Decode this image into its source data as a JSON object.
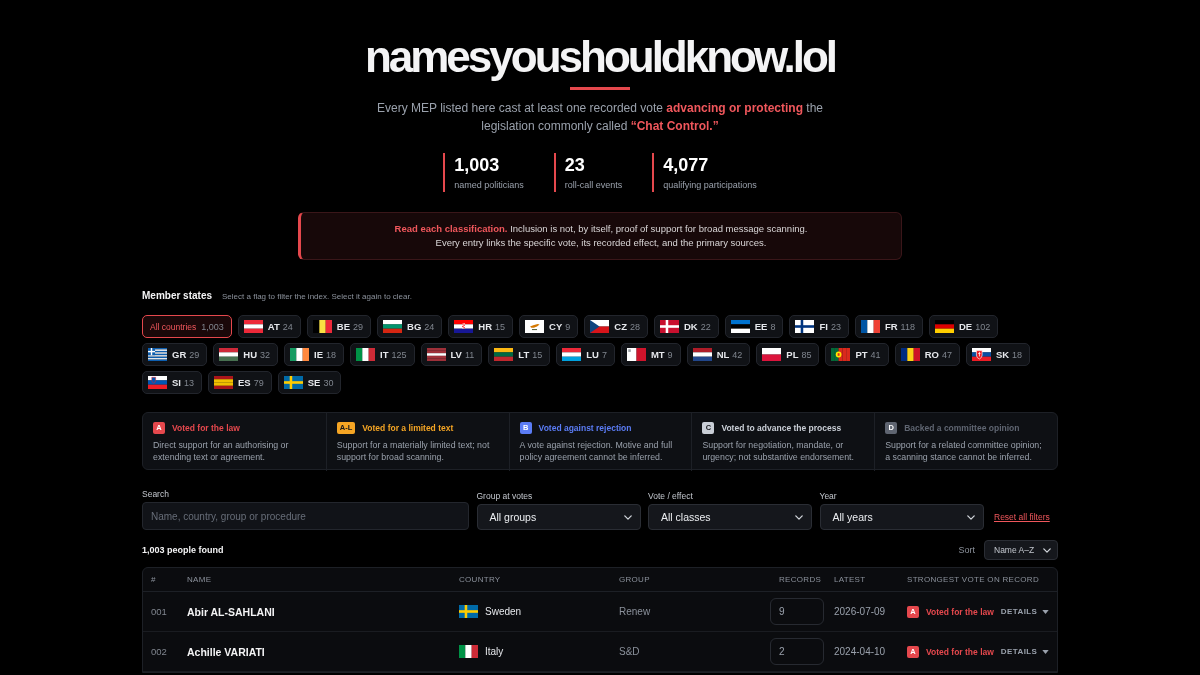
{
  "header": {
    "title": "namesyoushouldknow.lol",
    "intro": "Every MEP listed here cast at least one recorded vote **advancing or protecting** the legislation commonly called **“Chat Control.”**"
  },
  "stats": [
    {
      "value": "1,003",
      "label": "named politicians"
    },
    {
      "value": "23",
      "label": "roll-call events"
    },
    {
      "value": "4,077",
      "label": "qualifying participations"
    }
  ],
  "notice": {
    "lines": [
      "**Read each classification.** Inclusion is not, by itself, proof of support for broad message scanning.",
      "Every entry links the specific vote, its recorded effect, and the primary sources."
    ]
  },
  "member_states": {
    "heading": "Member states",
    "hint": "Select a flag to filter the index. Select it again to clear.",
    "chips": [
      {
        "kind": "all",
        "label": "All countries",
        "count": "1,003",
        "selected": true
      },
      {
        "kind": "austria",
        "label": "AT",
        "count": "24",
        "selected": false
      },
      {
        "kind": "belgium",
        "label": "BE",
        "count": "29",
        "selected": false
      },
      {
        "kind": "bulgaria",
        "label": "BG",
        "count": "24",
        "selected": false
      },
      {
        "kind": "croatia",
        "label": "HR",
        "count": "15",
        "selected": false
      },
      {
        "kind": "cyprus",
        "label": "CY",
        "count": "9",
        "selected": false
      },
      {
        "kind": "czechia",
        "label": "CZ",
        "count": "28",
        "selected": false
      },
      {
        "kind": "denmark",
        "label": "DK",
        "count": "22",
        "selected": false
      },
      {
        "kind": "estonia",
        "label": "EE",
        "count": "8",
        "selected": false
      },
      {
        "kind": "finland",
        "label": "FI",
        "count": "23",
        "selected": false
      },
      {
        "kind": "france",
        "label": "FR",
        "count": "118",
        "selected": false
      },
      {
        "kind": "germany",
        "label": "DE",
        "count": "102",
        "selected": false
      },
      {
        "kind": "greece",
        "label": "GR",
        "count": "29",
        "selected": false
      },
      {
        "kind": "hungary",
        "label": "HU",
        "count": "32",
        "selected": false
      },
      {
        "kind": "ireland",
        "label": "IE",
        "count": "18",
        "selected": false
      },
      {
        "kind": "italy",
        "label": "IT",
        "count": "125",
        "selected": false
      },
      {
        "kind": "latvia",
        "label": "LV",
        "count": "11",
        "selected": false
      },
      {
        "kind": "lithuania",
        "label": "LT",
        "count": "15",
        "selected": false
      },
      {
        "kind": "luxembourg",
        "label": "LU",
        "count": "7",
        "selected": false
      },
      {
        "kind": "malta",
        "label": "MT",
        "count": "9",
        "selected": false
      },
      {
        "kind": "netherlands",
        "label": "NL",
        "count": "42",
        "selected": false
      },
      {
        "kind": "poland",
        "label": "PL",
        "count": "85",
        "selected": false
      },
      {
        "kind": "portugal",
        "label": "PT",
        "count": "41",
        "selected": false
      },
      {
        "kind": "romania",
        "label": "RO",
        "count": "47",
        "selected": false
      },
      {
        "kind": "slovakia",
        "label": "SK",
        "count": "18",
        "selected": false
      },
      {
        "kind": "slovenia",
        "label": "SI",
        "count": "13",
        "selected": false
      },
      {
        "kind": "spain",
        "label": "ES",
        "count": "79",
        "selected": false
      },
      {
        "kind": "sweden",
        "label": "SE",
        "count": "30",
        "selected": false
      }
    ]
  },
  "classes": [
    {
      "badge": "A",
      "title": "Voted for the law",
      "description": "Direct support for an authorising or extending text or agreement.",
      "color": "#e5484d"
    },
    {
      "badge": "A-L",
      "title": "Voted for a limited text",
      "description": "Support for a materially limited text; not support for broad scanning.",
      "color": "#f5a524"
    },
    {
      "badge": "B",
      "title": "Voted against rejection",
      "description": "A vote against rejection. Motive and full policy agreement cannot be inferred.",
      "color": "#5b7cf5"
    },
    {
      "badge": "C",
      "title": "Voted to advance the process",
      "description": "Support for negotiation, mandate, or urgency; not substantive endorsement.",
      "color": "#c9ced6"
    },
    {
      "badge": "D",
      "title": "Backed a committee opinion",
      "description": "Support for a related committee opinion; a scanning stance cannot be inferred.",
      "color": "#5f6571"
    }
  ],
  "filters": {
    "search": {
      "label": "Search",
      "placeholder": "Name, country, group or procedure"
    },
    "selects": [
      {
        "label": "Group at votes",
        "value": "All groups"
      },
      {
        "label": "Vote / effect",
        "value": "All classes"
      },
      {
        "label": "Year",
        "value": "All years"
      }
    ],
    "reset": "Reset all filters"
  },
  "results": {
    "count": "1,003 people found",
    "sort_label": "Sort",
    "sort_value": "Name A–Z"
  },
  "table": {
    "columns": [
      "#",
      "NAME",
      "COUNTRY",
      "GROUP",
      "RECORDS",
      "LATEST",
      "STRONGEST VOTE ON RECORD"
    ],
    "rows": [
      {
        "number": "001",
        "name": "Abir AL-SAHLANI",
        "country": {
          "name": "Sweden",
          "kind": "sweden"
        },
        "group": "Renew",
        "records": "9",
        "latest": "2026-07-09",
        "vote": {
          "badge": "A",
          "label": "Voted for the law",
          "color": "#e5484d"
        },
        "details": "DETAILS"
      },
      {
        "number": "002",
        "name": "Achille VARIATI",
        "country": {
          "name": "Italy",
          "kind": "italy"
        },
        "group": "S&D",
        "records": "2",
        "latest": "2024-04-10",
        "vote": {
          "badge": "A",
          "label": "Voted for the law",
          "color": "#e5484d"
        },
        "details": "DETAILS"
      }
    ]
  }
}
